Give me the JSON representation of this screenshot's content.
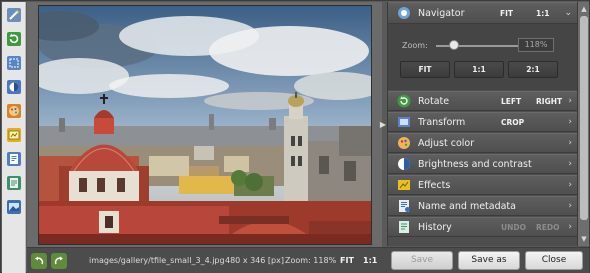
{
  "toolbar": {
    "tools": [
      {
        "icon": "magic-wand-icon"
      },
      {
        "icon": "rotate-icon"
      },
      {
        "icon": "crop-icon"
      },
      {
        "icon": "adjust-color-icon"
      },
      {
        "icon": "palette-icon"
      },
      {
        "icon": "effects-icon"
      },
      {
        "icon": "info-icon"
      },
      {
        "icon": "history-icon"
      },
      {
        "icon": "image-icon"
      }
    ]
  },
  "navigator": {
    "title": "Navigator",
    "fit_label": "FIT",
    "one_to_one_label": "1:1",
    "zoom_label": "Zoom:",
    "zoom_value": "118%",
    "zoom_fraction": 0.18,
    "buttons": [
      "FIT",
      "1:1",
      "2:1"
    ]
  },
  "sections": [
    {
      "label": "Rotate",
      "icon": "rotate-icon",
      "actions": [
        "LEFT",
        "RIGHT"
      ]
    },
    {
      "label": "Transform",
      "icon": "transform-icon",
      "actions": [
        "CROP"
      ]
    },
    {
      "label": "Adjust color",
      "icon": "adjust-color-icon",
      "actions": []
    },
    {
      "label": "Brightness and contrast",
      "icon": "brightness-icon",
      "actions": []
    },
    {
      "label": "Effects",
      "icon": "effects-icon",
      "actions": []
    },
    {
      "label": "Name and metadata",
      "icon": "metadata-icon",
      "actions": []
    },
    {
      "label": "History",
      "icon": "history-icon",
      "actions": [
        "UNDO",
        "REDO"
      ]
    }
  ],
  "status": {
    "filename": "images/gallery/tfile_small_3_4.jpg",
    "dimensions": "480 x 346 [px]",
    "zoom": "Zoom: 118%",
    "fit": "FIT",
    "one_to_one": "1:1"
  },
  "buttons": {
    "save": "Save",
    "save_as": "Save as",
    "close": "Close"
  },
  "colors": {
    "panel_bg": "#4e4e4e",
    "header_bg": "#5a5a5a",
    "undo_green": "#5e8c3a"
  }
}
